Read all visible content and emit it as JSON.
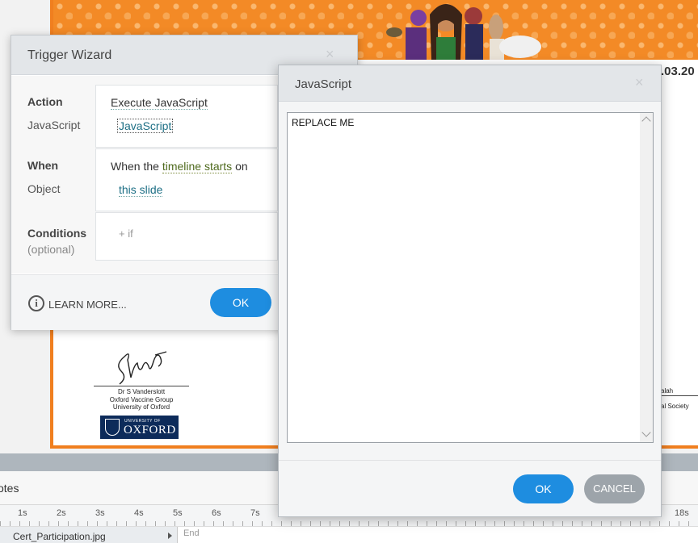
{
  "slide": {
    "date_fragment": ".03.20",
    "signature": {
      "name": "Dr S Vanderslott",
      "org": "Oxford Vaccine Group",
      "university": "University of Oxford"
    },
    "oxford_logo": {
      "small": "UNIVERSITY OF",
      "big": "OXFORD"
    },
    "right_sig_name": "alah",
    "right_sig_org": "al Society"
  },
  "trigger_wizard": {
    "title": "Trigger Wizard",
    "close_glyph": "×",
    "action": {
      "label": "Action",
      "value": "Execute JavaScript",
      "sub_label": "JavaScript",
      "sub_value": "JavaScript"
    },
    "when": {
      "label": "When",
      "prefix": "When the",
      "event": "timeline starts",
      "suffix": "on",
      "sub_label": "Object",
      "object": "this slide"
    },
    "conditions": {
      "label": "Conditions",
      "optional": "(optional)",
      "add": "+ if"
    },
    "footer": {
      "info_glyph": "i",
      "learn_more": "LEARN MORE...",
      "ok": "OK"
    }
  },
  "javascript_dialog": {
    "title": "JavaScript",
    "close_glyph": "×",
    "code": "REPLACE ME",
    "ok": "OK",
    "cancel": "CANCEL"
  },
  "timeline": {
    "notes_label": "otes",
    "ruler_labels": [
      "1s",
      "2s",
      "3s",
      "4s",
      "5s",
      "6s",
      "7s",
      "18s"
    ],
    "item_label": "Cert_Participation.jpg",
    "end_label": "End"
  },
  "colors": {
    "accent_blue": "#1e8de0",
    "slide_orange": "#f38a26",
    "cancel_grey": "#9da4aa"
  }
}
